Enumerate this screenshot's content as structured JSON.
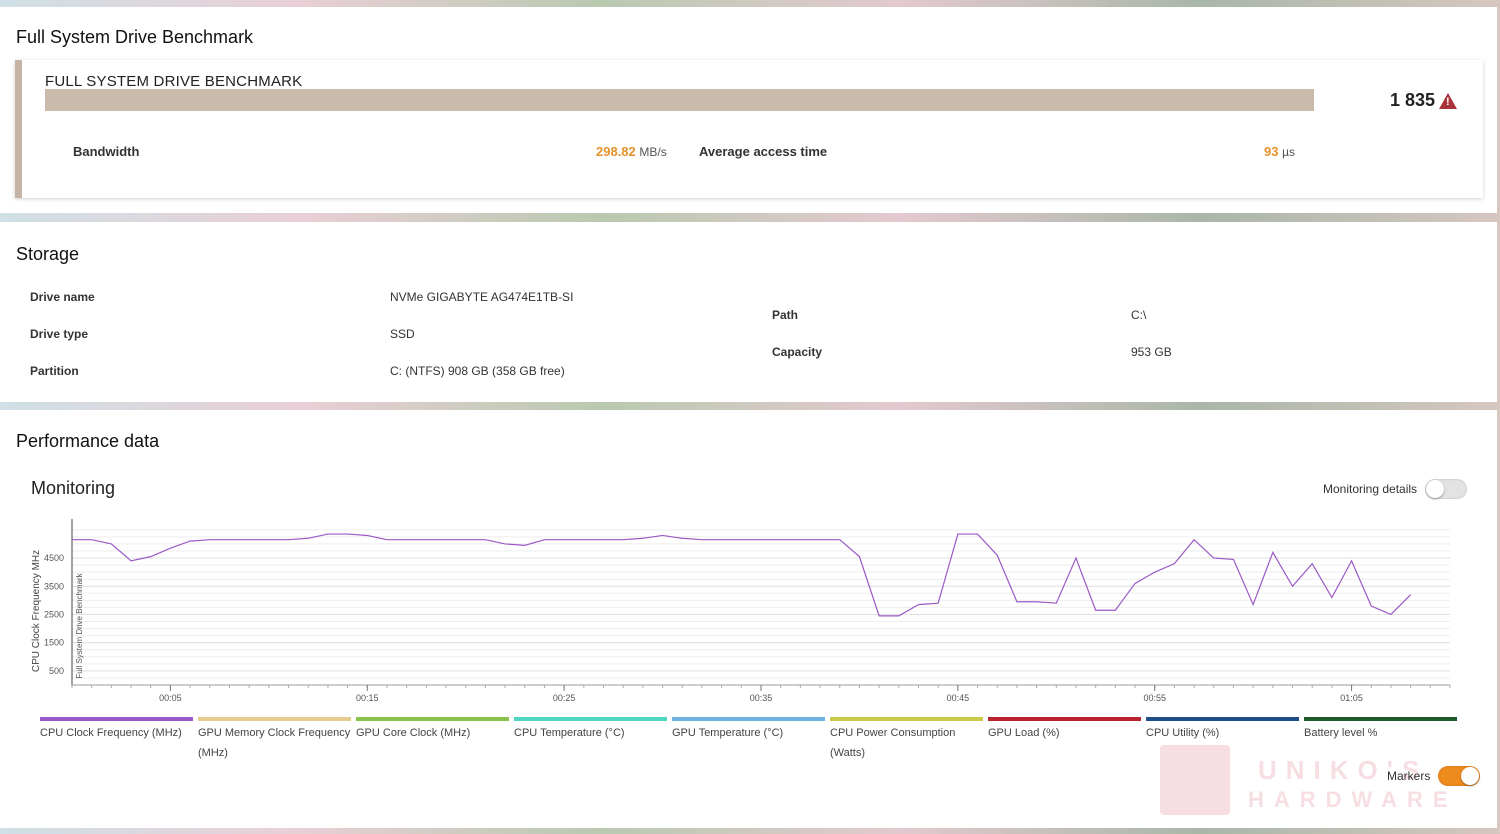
{
  "benchmark": {
    "section_title": "Full System Drive Benchmark",
    "card_title": "FULL SYSTEM DRIVE BENCHMARK",
    "score": "1 835",
    "warning_icon": "warning-triangle-icon",
    "bandwidth_label": "Bandwidth",
    "bandwidth_value": "298.82",
    "bandwidth_unit": "MB/s",
    "access_label": "Average access time",
    "access_value": "93",
    "access_unit": "µs",
    "value_color": "#e6922a",
    "bar_color": "#c9baab"
  },
  "storage": {
    "section_title": "Storage",
    "drive_name_label": "Drive name",
    "drive_name": "NVMe GIGABYTE AG474E1TB-SI",
    "drive_type_label": "Drive type",
    "drive_type": "SSD",
    "partition_label": "Partition",
    "partition": "C: (NTFS) 908 GB (358 GB free)",
    "path_label": "Path",
    "path": "C:\\",
    "capacity_label": "Capacity",
    "capacity": "953 GB"
  },
  "performance": {
    "section_title": "Performance data",
    "monitoring_title": "Monitoring",
    "monitoring_details_label": "Monitoring details",
    "monitoring_details_on": false,
    "markers_label": "Markers",
    "markers_on": true,
    "legend": [
      {
        "label": "CPU Clock Frequency (MHz)",
        "color": "#9b59c6"
      },
      {
        "label": "GPU Memory Clock Frequency (MHz)",
        "color": "#e6cd8e"
      },
      {
        "label": "GPU Core Clock (MHz)",
        "color": "#8bc34a"
      },
      {
        "label": "CPU Temperature (°C)",
        "color": "#4fd6c0"
      },
      {
        "label": "GPU Temperature (°C)",
        "color": "#6fb3e0"
      },
      {
        "label": "CPU Power Consumption (Watts)",
        "color": "#c9c94a"
      },
      {
        "label": "GPU Load (%)",
        "color": "#b8232f"
      },
      {
        "label": "CPU Utility (%)",
        "color": "#1f4e8a"
      },
      {
        "label": "Battery level %",
        "color": "#1e5a2a"
      }
    ],
    "watermark": {
      "line1": "UNIKO'S",
      "line2": "HARDWARE"
    }
  },
  "chart_data": {
    "type": "line",
    "ylabel": "CPU Clock Frequency MHz",
    "marker_label": "Full System Drive Benchmark",
    "y_ticks": [
      500,
      1500,
      2500,
      3500,
      4500
    ],
    "ylim": [
      0,
      5600
    ],
    "xlim": [
      0,
      70
    ],
    "x_ticks": [
      "00:05",
      "00:15",
      "00:25",
      "00:35",
      "00:45",
      "00:55",
      "01:05"
    ],
    "x_tick_seconds": [
      5,
      15,
      25,
      35,
      45,
      55,
      65
    ],
    "grid": true,
    "series": [
      {
        "name": "CPU Clock Frequency (MHz)",
        "color": "#9b59c6",
        "x": [
          0,
          1,
          2,
          3,
          4,
          5,
          6,
          7,
          8,
          9,
          10,
          11,
          12,
          13,
          14,
          15,
          16,
          17,
          18,
          19,
          20,
          21,
          22,
          23,
          24,
          25,
          26,
          27,
          28,
          29,
          30,
          31,
          32,
          33,
          34,
          35,
          36,
          37,
          38,
          39,
          40,
          41,
          42,
          43,
          44,
          45,
          46,
          47,
          48,
          49,
          50,
          51,
          52,
          53,
          54,
          55,
          56,
          57,
          58,
          59,
          60,
          61,
          62,
          63,
          64,
          65,
          66,
          67,
          68
        ],
        "values": [
          5150,
          5150,
          5000,
          4400,
          4550,
          4850,
          5100,
          5150,
          5150,
          5150,
          5150,
          5150,
          5200,
          5350,
          5350,
          5300,
          5150,
          5150,
          5150,
          5150,
          5150,
          5150,
          5000,
          4950,
          5150,
          5150,
          5150,
          5150,
          5150,
          5200,
          5300,
          5200,
          5150,
          5150,
          5150,
          5150,
          5150,
          5150,
          5150,
          5150,
          4550,
          2450,
          2450,
          2850,
          2900,
          5350,
          5350,
          4600,
          2950,
          2950,
          2900,
          4500,
          2650,
          2650,
          3600,
          4000,
          4300,
          5150,
          4500,
          4450,
          2850,
          4700,
          3500,
          4300,
          3100,
          4400,
          2800,
          2500,
          3200
        ]
      }
    ]
  }
}
